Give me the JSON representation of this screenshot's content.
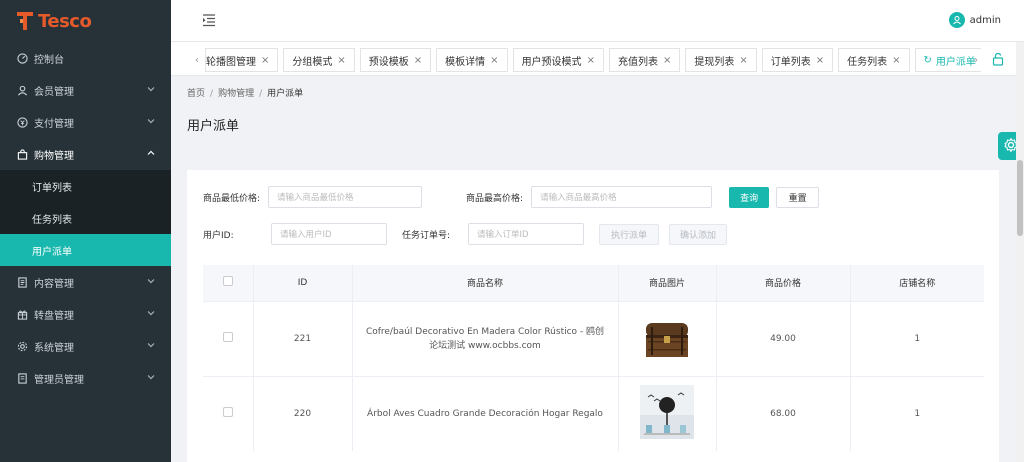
{
  "brand": {
    "name": "Tesco",
    "color": "#e55a2b"
  },
  "accent": "#19b8ae",
  "sidebar": {
    "items": [
      {
        "label": "控制台",
        "icon": "dashboard-icon"
      },
      {
        "label": "会员管理",
        "icon": "user-icon"
      },
      {
        "label": "支付管理",
        "icon": "payment-icon"
      },
      {
        "label": "购物管理",
        "icon": "shopping-bag-icon",
        "open": true
      },
      {
        "label": "内容管理",
        "icon": "document-icon"
      },
      {
        "label": "转盘管理",
        "icon": "gift-icon"
      },
      {
        "label": "系统管理",
        "icon": "gear-icon"
      },
      {
        "label": "管理员管理",
        "icon": "admin-icon"
      }
    ],
    "sub_items": [
      {
        "label": "订单列表"
      },
      {
        "label": "任务列表"
      },
      {
        "label": "用户派单",
        "active": true
      }
    ]
  },
  "header": {
    "username": "admin"
  },
  "tabs": [
    {
      "label": "轮播图管理"
    },
    {
      "label": "分组模式"
    },
    {
      "label": "预设模板"
    },
    {
      "label": "模板详情"
    },
    {
      "label": "用户预设模式"
    },
    {
      "label": "充值列表"
    },
    {
      "label": "提现列表"
    },
    {
      "label": "订单列表"
    },
    {
      "label": "任务列表"
    },
    {
      "label": "用户派单",
      "active": true
    }
  ],
  "breadcrumb": {
    "home": "首页",
    "parent": "购物管理",
    "current": "用户派单"
  },
  "page_title": "用户派单",
  "form": {
    "min_price_label": "商品最低价格:",
    "min_price_placeholder": "请输入商品最低价格",
    "max_price_label": "商品最高价格:",
    "max_price_placeholder": "请输入商品最高价格",
    "query_btn": "查询",
    "reset_btn": "重置",
    "user_id_label": "用户ID:",
    "user_id_placeholder": "请输入用户ID",
    "order_no_label": "任务订单号:",
    "order_no_placeholder": "请输入订单ID",
    "dispatch_btn": "执行派单",
    "confirm_btn": "确认添加"
  },
  "table": {
    "headers": [
      "ID",
      "商品名称",
      "商品图片",
      "商品价格",
      "店铺名称"
    ],
    "rows": [
      {
        "id": "221",
        "name": "Cofre/baúl Decorativo En Madera Color Rústico - 鸥创论坛测试 www.ocbbs.com",
        "price": "49.00",
        "shop": "1",
        "image": "wooden-chest-image"
      },
      {
        "id": "220",
        "name": "Árbol Aves Cuadro Grande Decoración Hogar Regalo",
        "price": "68.00",
        "shop": "1",
        "image": "tree-birds-painting-image"
      }
    ]
  }
}
